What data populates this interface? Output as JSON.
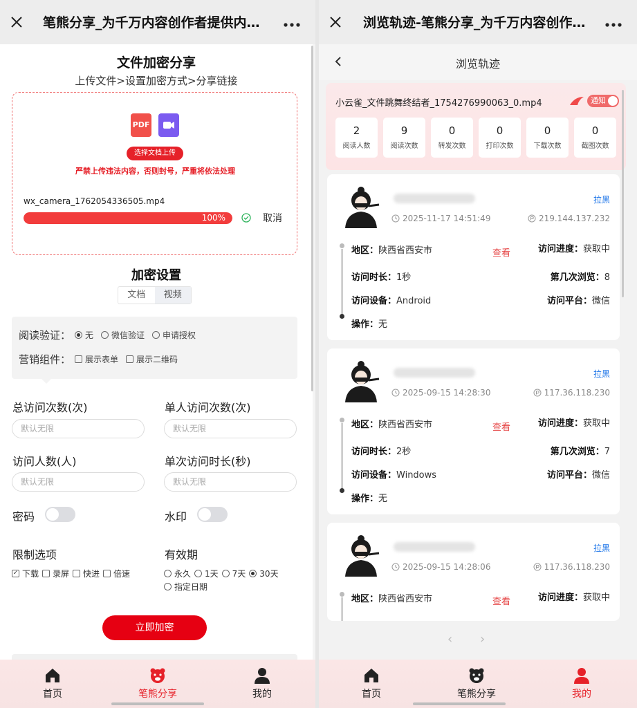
{
  "left": {
    "window_title": "笔熊分享_为千万内容创作者提供内…",
    "heading": "文件加密分享",
    "steps": "上传文件>设置加密方式>分享链接",
    "upload": {
      "pdf_label": "PDF",
      "button": "选择文档上传",
      "warning": "严禁上传违法内容，否则封号，严重将依法处理",
      "file_name": "wx_camera_1762054336505.mp4",
      "progress": 100,
      "progress_text": "100%",
      "cancel": "取消"
    },
    "encrypt_title": "加密设置",
    "segments": [
      "文档",
      "视频"
    ],
    "read_verify": {
      "label": "阅读验证：",
      "options": [
        "无",
        "微信验证",
        "申请授权"
      ],
      "selected": 0
    },
    "marketing": {
      "label": "营销组件：",
      "options": [
        "展示表单",
        "展示二维码"
      ]
    },
    "fields": {
      "total_visits": {
        "label": "总访问次数(次)",
        "placeholder": "默认无限"
      },
      "single_visits": {
        "label": "单人访问次数(次)",
        "placeholder": "默认无限"
      },
      "visitors": {
        "label": "访问人数(人)",
        "placeholder": "默认无限"
      },
      "duration": {
        "label": "单次访问时长(秒)",
        "placeholder": "默认无限"
      }
    },
    "password_label": "密码",
    "watermark_label": "水印",
    "limits": {
      "label": "限制选项",
      "options": [
        "下载",
        "录屏",
        "快进",
        "倍速"
      ],
      "checked": [
        0
      ]
    },
    "validity": {
      "label": "有效期",
      "options": [
        "永久",
        "1天",
        "7天",
        "30天",
        "指定日期"
      ],
      "selected": 3
    },
    "submit": "立即加密",
    "tabs": [
      "首页",
      "笔熊分享",
      "我的"
    ],
    "active_tab": 1
  },
  "right": {
    "window_title": "浏览轨迹-笔熊分享_为千万内容创作…",
    "header_title": "浏览轨迹",
    "summary": {
      "file_name": "小云雀_文件跳舞终结者_1754276990063_0.mp4",
      "notice_label": "通知",
      "stats": [
        {
          "value": "2",
          "label": "阅读人数"
        },
        {
          "value": "9",
          "label": "阅读次数"
        },
        {
          "value": "0",
          "label": "转发次数"
        },
        {
          "value": "0",
          "label": "打印次数"
        },
        {
          "value": "0",
          "label": "下载次数"
        },
        {
          "value": "0",
          "label": "截图次数"
        }
      ]
    },
    "visits": [
      {
        "block": "拉黑",
        "time": "2025-11-17 14:51:49",
        "ip": "219.144.137.232",
        "region_k": "地区：",
        "region": "陕西省西安市",
        "view": "查看",
        "progress_k": "访问进度：",
        "progress": "获取中",
        "dur_k": "访问时长：",
        "duration": "1秒",
        "nth_k": "第几次浏览：",
        "nth": "8",
        "dev_k": "访问设备：",
        "device": "Android",
        "plat_k": "访问平台：",
        "platform": "微信",
        "op_k": "操作：",
        "op": "无"
      },
      {
        "block": "拉黑",
        "time": "2025-09-15 14:28:30",
        "ip": "117.36.118.230",
        "region_k": "地区：",
        "region": "陕西省西安市",
        "view": "查看",
        "progress_k": "访问进度：",
        "progress": "获取中",
        "dur_k": "访问时长：",
        "duration": "2秒",
        "nth_k": "第几次浏览：",
        "nth": "7",
        "dev_k": "访问设备：",
        "device": "Windows",
        "plat_k": "访问平台：",
        "platform": "微信",
        "op_k": "操作：",
        "op": "无"
      },
      {
        "block": "拉黑",
        "time": "2025-09-15 14:28:06",
        "ip": "117.36.118.230",
        "region_k": "地区：",
        "region": "陕西省西安市",
        "view": "查看",
        "progress_k": "访问进度：",
        "progress": "获取中"
      }
    ],
    "tabs": [
      "首页",
      "笔熊分享",
      "我的"
    ],
    "active_tab": 2
  },
  "colors": {
    "accent": "#e62129",
    "link": "#1a73e8",
    "tab_bg": "#fbe6e6"
  }
}
